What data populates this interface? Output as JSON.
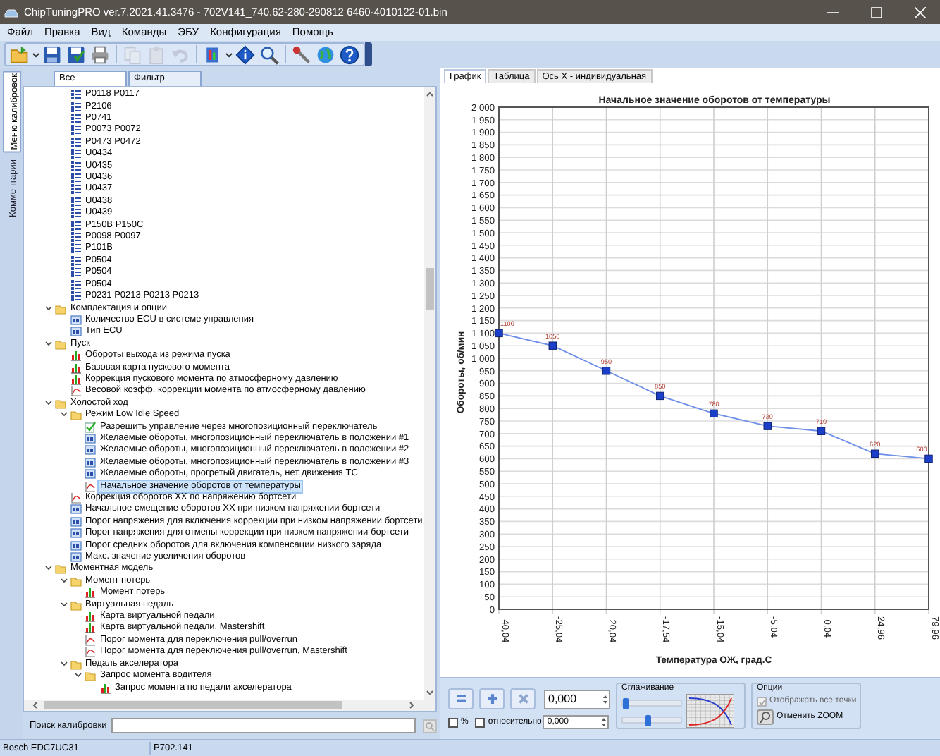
{
  "window": {
    "title": "ChipTuningPRO ver.7.2021.41.3476 - 702V141_740.62-280-290812 6460-4010122-01.bin"
  },
  "menu": [
    "Файл",
    "Правка",
    "Вид",
    "Команды",
    "ЭБУ",
    "Конфигурация",
    "Помощь"
  ],
  "toolbar_groups": [
    {
      "buttons": [
        {
          "kind": "open",
          "disabled": false,
          "dropdown": true
        },
        {
          "kind": "save",
          "disabled": false,
          "dropdown": false
        },
        {
          "kind": "save_as",
          "disabled": false,
          "dropdown": false
        },
        {
          "kind": "print",
          "disabled": false,
          "dropdown": false
        }
      ]
    },
    {
      "buttons": [
        {
          "kind": "copy",
          "disabled": true,
          "dropdown": false
        },
        {
          "kind": "paste",
          "disabled": true,
          "dropdown": false
        },
        {
          "kind": "undo",
          "disabled": true,
          "dropdown": false
        }
      ]
    },
    {
      "buttons": [
        {
          "kind": "ecu",
          "disabled": false,
          "dropdown": true
        },
        {
          "kind": "info",
          "disabled": false,
          "dropdown": false
        },
        {
          "kind": "search",
          "disabled": false,
          "dropdown": false
        }
      ]
    },
    {
      "buttons": [
        {
          "kind": "tool",
          "disabled": false,
          "dropdown": false
        },
        {
          "kind": "globe",
          "disabled": false,
          "dropdown": false
        },
        {
          "kind": "help",
          "disabled": false,
          "dropdown": false
        }
      ]
    }
  ],
  "side_tabs": [
    {
      "label": "Меню калибровок",
      "selected": true
    },
    {
      "label": "Комментарии",
      "selected": false
    }
  ],
  "tree_tabs": [
    {
      "label": "Все",
      "selected": true
    },
    {
      "label": "Фильтр",
      "selected": false
    }
  ],
  "tree": {
    "continued_items": [
      {
        "label": "P0118 P0117",
        "kind": "dtc",
        "selected": false
      },
      {
        "label": "P2106",
        "kind": "dtc",
        "selected": false
      },
      {
        "label": "P0741",
        "kind": "dtc",
        "selected": false
      },
      {
        "label": "P0073 P0072",
        "kind": "dtc",
        "selected": false
      },
      {
        "label": "P0473 P0472",
        "kind": "dtc",
        "selected": false
      },
      {
        "label": "U0434",
        "kind": "dtc",
        "selected": false
      },
      {
        "label": "U0435",
        "kind": "dtc",
        "selected": false
      },
      {
        "label": "U0436",
        "kind": "dtc",
        "selected": false
      },
      {
        "label": "U0437",
        "kind": "dtc",
        "selected": false
      },
      {
        "label": "U0438",
        "kind": "dtc",
        "selected": false
      },
      {
        "label": "U0439",
        "kind": "dtc",
        "selected": false
      },
      {
        "label": "P150B P150C",
        "kind": "dtc",
        "selected": false
      },
      {
        "label": "P0098 P0097",
        "kind": "dtc",
        "selected": false
      },
      {
        "label": "P101B",
        "kind": "dtc",
        "selected": false
      },
      {
        "label": "P0504",
        "kind": "dtc",
        "selected": false
      },
      {
        "label": "P0504",
        "kind": "dtc",
        "selected": false
      },
      {
        "label": "P0504",
        "kind": "dtc",
        "selected": false
      },
      {
        "label": "P0231 P0213 P0213 P0213",
        "kind": "dtc",
        "selected": false
      }
    ],
    "items": [
      {
        "label": "Комплектация и опции",
        "kind": "folder",
        "expanded": true,
        "selected": false,
        "children": [
          {
            "label": "Количество ECU в системе управления",
            "kind": "value",
            "selected": false
          },
          {
            "label": "Тип ECU",
            "kind": "value",
            "selected": false
          }
        ]
      },
      {
        "label": "Пуск",
        "kind": "folder",
        "expanded": true,
        "selected": false,
        "children": [
          {
            "label": "Обороты выхода из режима пуска",
            "kind": "map3d",
            "selected": false
          },
          {
            "label": "Базовая карта пускового момента",
            "kind": "map3d",
            "selected": false
          },
          {
            "label": "Коррекция пускового момента по атмосферному давлению",
            "kind": "map3d",
            "selected": false
          },
          {
            "label": "Весовой коэфф. коррекции момента по атмосферному давлению",
            "kind": "map2d",
            "selected": false
          }
        ]
      },
      {
        "label": "Холостой ход",
        "kind": "folder",
        "expanded": true,
        "selected": false,
        "children": [
          {
            "label": "Режим Low Idle Speed",
            "kind": "folder",
            "expanded": true,
            "selected": false,
            "children": [
              {
                "label": "Разрешить управление через многопозиционный переключатель",
                "kind": "flag",
                "selected": false
              },
              {
                "label": "Желаемые обороты, многопозиционный переключатель в положении #1",
                "kind": "value",
                "selected": false
              },
              {
                "label": "Желаемые обороты, многопозиционный переключатель в положении #2",
                "kind": "value",
                "selected": false
              },
              {
                "label": "Желаемые обороты, многопозиционный переключатель в положении #3",
                "kind": "value",
                "selected": false
              },
              {
                "label": "Желаемые обороты, прогретый двигатель, нет движения ТС",
                "kind": "value",
                "selected": false
              },
              {
                "label": "Начальное значение оборотов от температуры",
                "kind": "map2d",
                "selected": true
              }
            ]
          },
          {
            "label": "Коррекция оборотов XX по напряжению бортсети",
            "kind": "map2d",
            "selected": false
          },
          {
            "label": "Начальное смещение оборотов XX при низком напряжении бортсети",
            "kind": "value",
            "selected": false
          },
          {
            "label": "Порог напряжения для включения коррекции при низком напряжении бортсети",
            "kind": "value",
            "selected": false
          },
          {
            "label": "Порог напряжения для отмены коррекции при низком напряжении бортсети",
            "kind": "value",
            "selected": false
          },
          {
            "label": "Порог средних оборотов для включения компенсации низкого заряда",
            "kind": "value",
            "selected": false
          },
          {
            "label": "Макс. значение увеличения оборотов",
            "kind": "value",
            "selected": false
          }
        ]
      },
      {
        "label": "Моментная модель",
        "kind": "folder",
        "expanded": true,
        "selected": false,
        "children": [
          {
            "label": "Момент потерь",
            "kind": "folder",
            "expanded": true,
            "selected": false,
            "children": [
              {
                "label": "Момент потерь",
                "kind": "map3d",
                "selected": false
              }
            ]
          },
          {
            "label": "Виртуальная педаль",
            "kind": "folder",
            "expanded": true,
            "selected": false,
            "children": [
              {
                "label": "Карта виртуальной педали",
                "kind": "map3d",
                "selected": false
              },
              {
                "label": "Карта виртуальной педали, Mastershift",
                "kind": "map3d",
                "selected": false
              },
              {
                "label": "Порог момента для переключения pull/overrun",
                "kind": "map2d",
                "selected": false
              },
              {
                "label": "Порог момента для переключения pull/overrun, Mastershift",
                "kind": "map2d",
                "selected": false
              }
            ]
          },
          {
            "label": "Педаль акселератора",
            "kind": "folder",
            "expanded": true,
            "selected": false,
            "children": [
              {
                "label": "Запрос момента водителя",
                "kind": "folder",
                "expanded": true,
                "selected": false,
                "children": [
                  {
                    "label": "Запрос момента по педали акселератора",
                    "kind": "map3d",
                    "selected": false
                  }
                ]
              }
            ]
          }
        ]
      }
    ]
  },
  "search": {
    "label": "Поиск калибровки"
  },
  "view_tabs": [
    {
      "label": "График",
      "selected": true
    },
    {
      "label": "Таблица",
      "selected": false
    },
    {
      "label": "Ось X - индивидуальная",
      "selected": false
    }
  ],
  "chart_data": {
    "type": "line",
    "title": "Начальное значение оборотов от температуры",
    "xlabel": "Температура ОЖ, град.С",
    "ylabel": "Обороты, об/мин",
    "categories": [
      "-40,04",
      "-25,04",
      "-20,04",
      "-17,54",
      "-15,04",
      "-5,04",
      "-0,04",
      "24,96",
      "79,96"
    ],
    "grid": true,
    "series": [
      {
        "color": "#1b3fc8",
        "marker": "square",
        "values": [
          1100,
          1050,
          950,
          850,
          780,
          730,
          710,
          620,
          600
        ]
      }
    ],
    "ylim": [
      0,
      2000
    ],
    "yticks": [
      {
        "value": 2000,
        "label": "2 000"
      },
      {
        "value": 1950,
        "label": "1 950"
      },
      {
        "value": 1900,
        "label": "1 900"
      },
      {
        "value": 1850,
        "label": "1 850"
      },
      {
        "value": 1800,
        "label": "1 800"
      },
      {
        "value": 1750,
        "label": "1 750"
      },
      {
        "value": 1700,
        "label": "1 700"
      },
      {
        "value": 1650,
        "label": "1 650"
      },
      {
        "value": 1600,
        "label": "1 600"
      },
      {
        "value": 1550,
        "label": "1 550"
      },
      {
        "value": 1500,
        "label": "1 500"
      },
      {
        "value": 1450,
        "label": "1 450"
      },
      {
        "value": 1400,
        "label": "1 400"
      },
      {
        "value": 1350,
        "label": "1 350"
      },
      {
        "value": 1300,
        "label": "1 300"
      },
      {
        "value": 1250,
        "label": "1 250"
      },
      {
        "value": 1200,
        "label": "1 200"
      },
      {
        "value": 1150,
        "label": "1 150"
      },
      {
        "value": 1100,
        "label": "1 100"
      },
      {
        "value": 1050,
        "label": "1 050"
      },
      {
        "value": 1000,
        "label": "1 000"
      },
      950,
      900,
      850,
      800,
      750,
      700,
      650,
      600,
      550,
      500,
      450,
      400,
      350,
      300,
      250,
      200,
      150,
      100,
      50,
      0
    ],
    "data_labels": true
  },
  "controls": {
    "number_value": "0,000",
    "percent": {
      "label": "%",
      "checked": false
    },
    "relative": {
      "label": "относительно",
      "checked": false,
      "value": "0,000"
    },
    "smoothing": {
      "title": "Сглаживание",
      "sliders": [
        {
          "level": 0.05
        },
        {
          "level": 0.45
        }
      ]
    },
    "options": {
      "title": "Опции",
      "show_all_points": {
        "label": "Отображать все точки",
        "checked": true,
        "disabled": true
      },
      "reset_zoom": "Отменить ZOOM"
    }
  },
  "status_bar": [
    "Bosch EDC7UC31",
    "P702.141"
  ]
}
